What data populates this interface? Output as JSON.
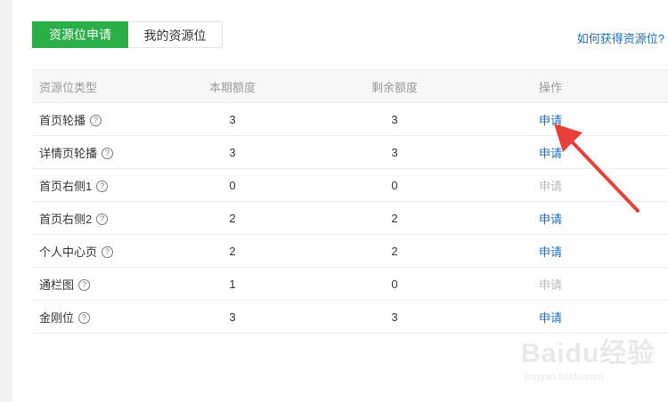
{
  "tabs": [
    {
      "label": "资源位申请",
      "active": true
    },
    {
      "label": "我的资源位",
      "active": false
    }
  ],
  "help_link": "如何获得资源位?",
  "table": {
    "headers": [
      "资源位类型",
      "本期额度",
      "剩余额度",
      "操作"
    ],
    "rows": [
      {
        "type": "首页轮播",
        "current": "3",
        "remaining": "3",
        "action": "申请",
        "enabled": true
      },
      {
        "type": "详情页轮播",
        "current": "3",
        "remaining": "3",
        "action": "申请",
        "enabled": true
      },
      {
        "type": "首页右侧1",
        "current": "0",
        "remaining": "0",
        "action": "申请",
        "enabled": false
      },
      {
        "type": "首页右侧2",
        "current": "2",
        "remaining": "2",
        "action": "申请",
        "enabled": true
      },
      {
        "type": "个人中心页",
        "current": "2",
        "remaining": "2",
        "action": "申请",
        "enabled": true
      },
      {
        "type": "通栏图",
        "current": "1",
        "remaining": "0",
        "action": "申请",
        "enabled": false
      },
      {
        "type": "金刚位",
        "current": "3",
        "remaining": "3",
        "action": "申请",
        "enabled": true
      }
    ]
  },
  "help_icon_glyph": "?",
  "watermark": {
    "main": "Baidu经验",
    "sub": "jingyan.baidu.com"
  },
  "colors": {
    "accent": "#2aae47",
    "link": "#1c6ec0",
    "disabled": "#bbbbbb",
    "arrow": "#e8403a"
  }
}
